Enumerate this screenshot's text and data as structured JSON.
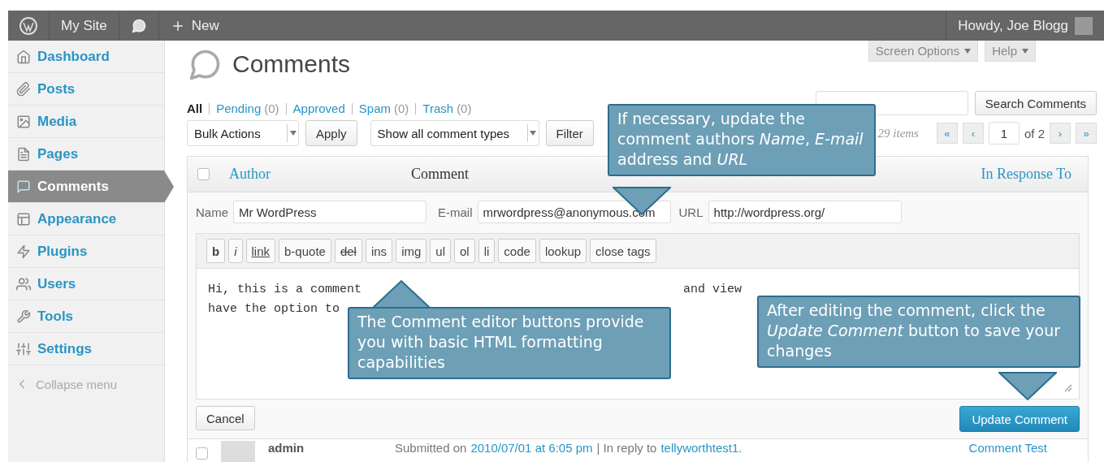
{
  "admin_bar": {
    "site": "My Site",
    "new": "New",
    "greeting": "Howdy, Joe Blogg"
  },
  "sidebar": {
    "items": [
      {
        "label": "Dashboard",
        "selected": false
      },
      {
        "label": "Posts",
        "selected": false
      },
      {
        "label": "Media",
        "selected": false
      },
      {
        "label": "Pages",
        "selected": false
      },
      {
        "label": "Comments",
        "selected": true
      },
      {
        "label": "Appearance",
        "selected": false
      },
      {
        "label": "Plugins",
        "selected": false
      },
      {
        "label": "Users",
        "selected": false
      },
      {
        "label": "Tools",
        "selected": false
      },
      {
        "label": "Settings",
        "selected": false
      }
    ],
    "collapse": "Collapse menu"
  },
  "header": {
    "title": "Comments",
    "screen_options": "Screen Options",
    "help": "Help"
  },
  "filters": [
    {
      "label": "All",
      "selected": true
    },
    {
      "label": "Pending",
      "count": "(0)",
      "selected": false
    },
    {
      "label": "Approved",
      "selected": false
    },
    {
      "label": "Spam",
      "count": "(0)",
      "selected": false
    },
    {
      "label": "Trash",
      "count": "(0)",
      "selected": false
    }
  ],
  "search_button": "Search Comments",
  "actions": {
    "bulk": "Bulk Actions",
    "apply": "Apply",
    "types": "Show all comment types",
    "filter": "Filter",
    "items": "29 items"
  },
  "pagination": {
    "first": "«",
    "prev": "‹",
    "page": "1",
    "of": "of 2",
    "next": "›",
    "last": "»"
  },
  "table": {
    "select_all_checked": false,
    "columns": [
      "Author",
      "Comment",
      "In Response To"
    ]
  },
  "edit": {
    "name_label": "Name",
    "name": "Mr WordPress",
    "email_label": "E-mail",
    "email": "mrwordpress@anonymous.com",
    "url_label": "URL",
    "url": "http://wordpress.org/",
    "toolbar": [
      {
        "label": "b",
        "kind": "bold"
      },
      {
        "label": "i",
        "kind": "italic"
      },
      {
        "label": "link",
        "kind": "underline"
      },
      {
        "label": "b-quote",
        "kind": "plain"
      },
      {
        "label": "del",
        "kind": "strike"
      },
      {
        "label": "ins",
        "kind": "plain"
      },
      {
        "label": "img",
        "kind": "plain"
      },
      {
        "label": "ul",
        "kind": "plain"
      },
      {
        "label": "ol",
        "kind": "plain"
      },
      {
        "label": "li",
        "kind": "plain"
      },
      {
        "label": "code",
        "kind": "plain"
      },
      {
        "label": "lookup",
        "kind": "plain"
      },
      {
        "label": "close tags",
        "kind": "plain"
      }
    ],
    "text_fragments": [
      "Hi, this is a comment",
      "and view",
      "have the option to"
    ],
    "cancel": "Cancel",
    "update": "Update Comment"
  },
  "next_row": {
    "checked": false,
    "author": "admin",
    "submitted": "Submitted on",
    "date": "2010/07/01 at 6:05 pm",
    "reply": "| In reply to",
    "post": "tellyworthtest1.",
    "response": "Comment Test"
  },
  "callouts": [
    {
      "text": "If necessary, update the comment authors *Name*, *E-mail* address and *URL*"
    },
    {
      "text": "The Comment editor buttons provide you with basic HTML formatting capabilities"
    },
    {
      "text": "After editing the comment, click the *Update Comment* button to save your changes"
    }
  ]
}
